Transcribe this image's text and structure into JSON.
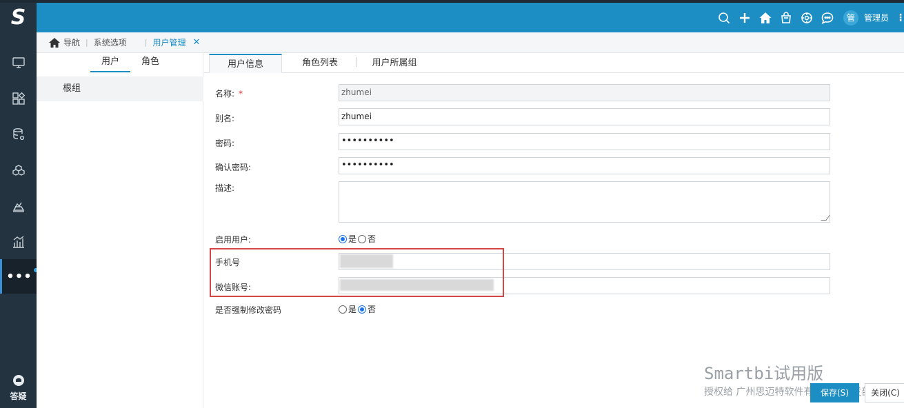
{
  "app": {
    "logo_letter": "S"
  },
  "header": {
    "avatar_char": "管",
    "username": "管理员"
  },
  "rail": {
    "items": [
      "monitor-icon",
      "apps-icon",
      "database-gear-icon",
      "cubes-icon",
      "layers-icon",
      "chart-bars-icon",
      "more-icon"
    ],
    "help_label": "答疑"
  },
  "breadcrumb": {
    "items": [
      "导航",
      "系统选项",
      "用户管理"
    ]
  },
  "left_panel": {
    "tabs": [
      "用户",
      "角色"
    ],
    "active_tab": "用户",
    "tree": [
      "根组"
    ]
  },
  "detail_tabs": {
    "items": [
      "用户信息",
      "角色列表",
      "用户所属组"
    ],
    "active": "用户信息"
  },
  "form": {
    "name_label": "名称:",
    "name_required": "*",
    "name_value": "zhumei",
    "alias_label": "别名:",
    "alias_value": "zhumei",
    "password_label": "密码:",
    "password_value": "••••••••••",
    "confirm_label": "确认密码:",
    "confirm_value": "••••••••••",
    "desc_label": "描述:",
    "desc_value": "",
    "enable_label": "启用用户:",
    "enable_options": [
      "是",
      "否"
    ],
    "enable_selected": "是",
    "phone_label": "手机号",
    "wechat_label": "微信账号:",
    "force_label": "是否强制修改密码",
    "force_options": [
      "是",
      "否"
    ],
    "force_selected": "否"
  },
  "watermark": {
    "line1": "Smartbi试用版",
    "line2": "授权给 广州思迈特软件有限公司研发部"
  },
  "actions": {
    "save": "保存(S)",
    "close": "关闭(C)"
  },
  "colors": {
    "header": "#1d8ec4",
    "rail": "#243340",
    "highlight": "#d64545"
  }
}
